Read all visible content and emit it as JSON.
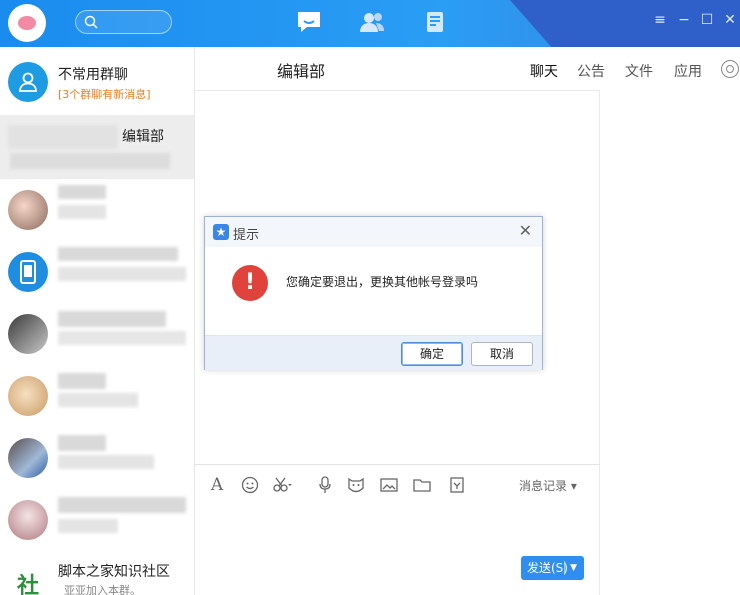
{
  "toolbar": {
    "search_placeholder": "",
    "nav": [
      "chat-bubble-icon",
      "contacts-icon",
      "apps-icon"
    ],
    "window_buttons": [
      "≡",
      "−",
      "☐",
      "✕"
    ]
  },
  "sidebar": {
    "items": [
      {
        "name": "不常用群聊",
        "sub": "[3个群聊有新消息]"
      },
      {
        "name": "编辑部",
        "sub": ""
      },
      {
        "name": "",
        "sub": ""
      },
      {
        "name": "",
        "sub": ""
      },
      {
        "name": "",
        "sub": ""
      },
      {
        "name": "",
        "sub": ""
      },
      {
        "name": "",
        "sub": ""
      },
      {
        "name": "",
        "sub": ""
      },
      {
        "name": "脚本之家知识社区",
        "sub": "亚亚加入本群。"
      }
    ]
  },
  "chat": {
    "title": "编辑部",
    "tabs": [
      "聊天",
      "公告",
      "文件",
      "应用"
    ],
    "history_label": "消息记录",
    "send_label": "发送(S)"
  },
  "dialog": {
    "title": "提示",
    "message": "您确定要退出，更换其他帐号登录吗",
    "ok_label": "确定",
    "cancel_label": "取消"
  },
  "colors": {
    "accent": "#2f8ef0",
    "titlebar": "#1a8cf0",
    "alert": "#e0423c",
    "notice": "#f07d1e"
  }
}
